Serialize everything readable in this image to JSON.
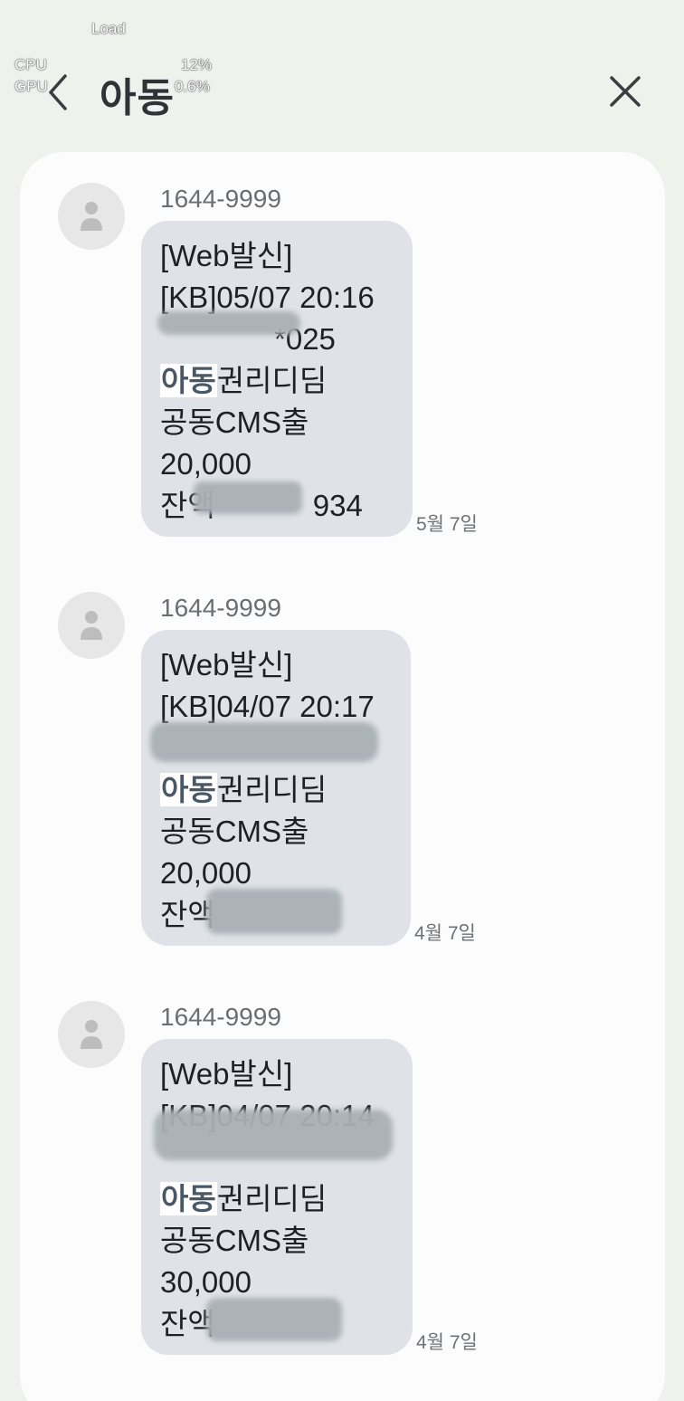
{
  "overlay": {
    "load": "Load",
    "cpu_label": "CPU",
    "gpu_label": "GPU",
    "cpu_value": "12%",
    "gpu_value": "0.6%"
  },
  "header": {
    "title": "아동"
  },
  "messages": [
    {
      "sender": "1644-9999",
      "lines": [
        "[Web발신]",
        "[KB]05/07 20:16",
        "*025",
        "아동",
        "권리디딤",
        "공동CMS출",
        "20,000",
        "잔액",
        "934"
      ],
      "date": "5월 7일"
    },
    {
      "sender": "1644-9999",
      "lines": [
        "[Web발신]",
        "[KB]04/07 20:17",
        "",
        "아동",
        "권리디딤",
        "공동CMS출",
        "20,000",
        "잔액",
        ""
      ],
      "date": "4월 7일"
    },
    {
      "sender": "1644-9999",
      "lines": [
        "[Web발신]",
        "[KB]04/07 20:14",
        "",
        "아동",
        "권리디딤",
        "공동CMS출",
        "30,000",
        "잔액",
        ""
      ],
      "date": "4월 7일"
    }
  ]
}
